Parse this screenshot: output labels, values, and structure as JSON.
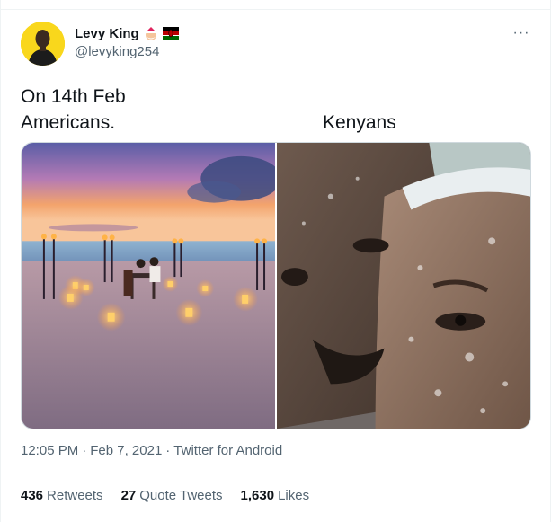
{
  "author": {
    "display_name": "Levy King",
    "handle": "@levyking254",
    "badges": [
      "santa-emoji",
      "kenya-flag"
    ]
  },
  "tweet": {
    "line1": "On 14th Feb",
    "caption_left": "Americans.",
    "caption_right": "Kenyans"
  },
  "media": {
    "images": [
      {
        "subject": "romantic-beach-dinner-at-sunset"
      },
      {
        "subject": "sweaty-couple-close-embrace"
      }
    ]
  },
  "meta": {
    "time": "12:05 PM",
    "dot1": "·",
    "date": "Feb 7, 2021",
    "dot2": "·",
    "source": "Twitter for Android"
  },
  "stats": {
    "retweets_count": "436",
    "retweets_label": "Retweets",
    "quotes_count": "27",
    "quotes_label": "Quote Tweets",
    "likes_count": "1,630",
    "likes_label": "Likes"
  },
  "menu": {
    "more_label": "···"
  }
}
